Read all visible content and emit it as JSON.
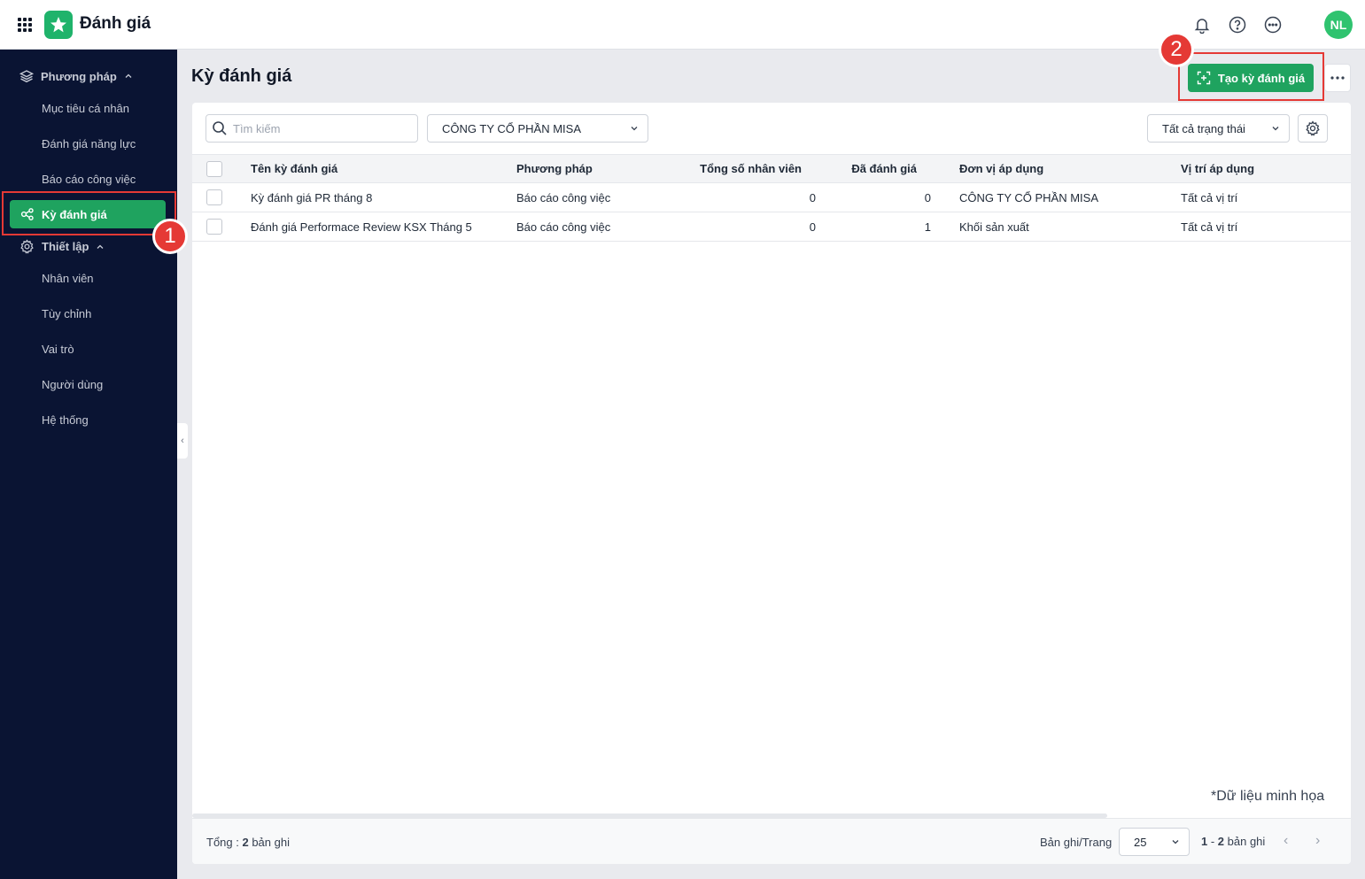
{
  "header": {
    "app_title": "Đánh giá",
    "avatar_initials": "NL",
    "icons": [
      "apps-grid-icon",
      "bell-icon",
      "help-icon",
      "chat-icon"
    ]
  },
  "sidebar": {
    "group1_label": "Phương pháp",
    "group1_items": [
      "Mục tiêu cá nhân",
      "Đánh giá năng lực",
      "Báo cáo công việc"
    ],
    "active_label": "Kỳ đánh giá",
    "group2_label": "Thiết lập",
    "group2_items": [
      "Nhân viên",
      "Tùy chỉnh",
      "Vai trò",
      "Người dùng",
      "Hệ thống"
    ]
  },
  "annotations": {
    "step1": "1",
    "step2": "2"
  },
  "page": {
    "title": "Kỳ đánh giá",
    "create_button": "Tạo kỳ đánh giá"
  },
  "filters": {
    "search_placeholder": "Tìm kiếm",
    "company_select": "CÔNG TY CỔ PHẦN MISA",
    "status_select": "Tất cả trạng thái"
  },
  "table": {
    "columns": [
      "Tên kỳ đánh giá",
      "Phương pháp",
      "Tổng số nhân viên",
      "Đã đánh giá",
      "Đơn vị áp dụng",
      "Vị trí áp dụng"
    ],
    "rows": [
      {
        "name": "Kỳ đánh giá PR tháng 8",
        "method": "Báo cáo công việc",
        "total": "0",
        "evaluated": "0",
        "unit": "CÔNG TY CỔ PHẦN MISA",
        "position": "Tất cả vị trí"
      },
      {
        "name": "Đánh giá Performace Review KSX Tháng 5",
        "method": "Báo cáo công việc",
        "total": "0",
        "evaluated": "1",
        "unit": "Khối sản xuất",
        "position": "Tất cả vị trí"
      }
    ]
  },
  "watermark": "*Dữ liệu minh họa",
  "footer": {
    "total_prefix": "Tổng : ",
    "total_count": "2",
    "total_suffix": " bản ghi",
    "per_page_label": "Bản ghi/Trang",
    "per_page_value": "25",
    "range_from": "1",
    "range_sep": " - ",
    "range_to": "2",
    "range_suffix": " bản ghi"
  },
  "colors": {
    "brand_green": "#1fa35f",
    "sidebar_bg": "#0a1433",
    "highlight_red": "#e53935"
  }
}
